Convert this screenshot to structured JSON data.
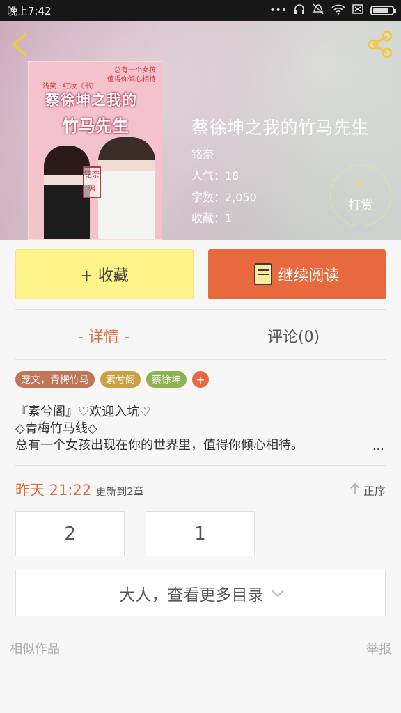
{
  "status_bar": {
    "time": "晚上7:42"
  },
  "cover": {
    "top_text_1": "总有一个女孩",
    "top_text_2": "值得你倾心相待",
    "side_text": "浅笑 · 红妆〔书〕",
    "title_line1": "蔡徐坤之我的",
    "title_line2": "竹马先生",
    "seal": "铭奈 著"
  },
  "book": {
    "title": "蔡徐坤之我的竹马先生",
    "author": "铭奈",
    "popularity": "人气：18",
    "word_count": "字数：2,050",
    "favorites": "收藏：1"
  },
  "reward": {
    "count": "0",
    "label": "打赏"
  },
  "actions": {
    "favorite": "+ 收藏",
    "continue_reading": "继续阅读"
  },
  "tabs": {
    "detail": "- 详情 -",
    "comments": "评论(0)"
  },
  "tags": [
    {
      "label": "宠文，青梅竹马",
      "color": "#c07458"
    },
    {
      "label": "素兮阁",
      "color": "#c9a140"
    },
    {
      "label": "蔡徐坤",
      "color": "#8fb24f"
    }
  ],
  "tag_add": "+",
  "description": {
    "line1": "『素兮阁』♡欢迎入坑♡",
    "line2": "◇青梅竹马线◇",
    "line3": "总有一个女孩出现在你的世界里，值得你倾心相待。",
    "more": "..."
  },
  "update": {
    "when": "昨天 21:22",
    "chapters": "更新到2章"
  },
  "sort": {
    "label": "正序"
  },
  "chapters": [
    "2",
    "1"
  ],
  "more_catalog": "大人，查看更多目录",
  "footer": {
    "similar": "相似作品",
    "report": "举报"
  },
  "colors": {
    "accent": "#e8693d",
    "favorite_button": "#fdf388"
  }
}
